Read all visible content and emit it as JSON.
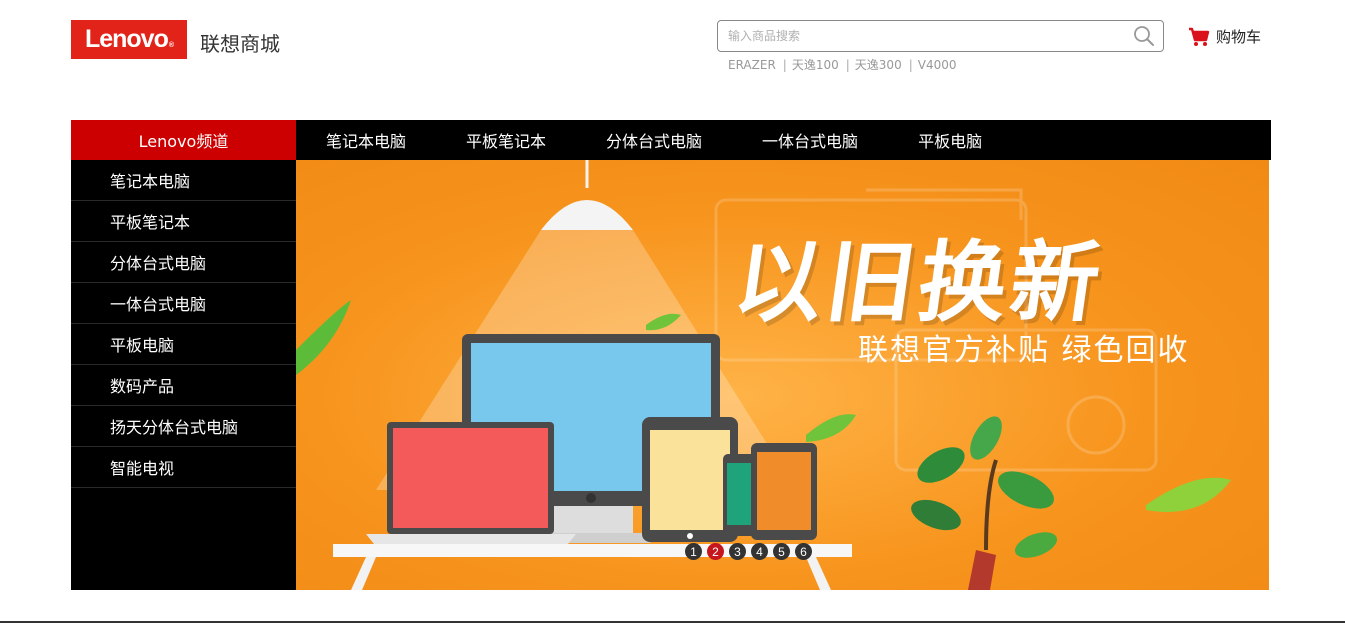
{
  "header": {
    "logo_text": "Lenovo",
    "logo_mark": "®",
    "site_name": "联想商城",
    "search_placeholder": "输入商品搜索",
    "search_icon": "search-icon",
    "hot_words": [
      "ERAZER",
      "天逸100",
      "天逸300",
      "V4000"
    ],
    "cart_label": "购物车",
    "cart_icon": "shopping-cart-icon"
  },
  "nav": {
    "channel_label": "Lenovo频道",
    "items": [
      "笔记本电脑",
      "平板笔记本",
      "分体台式电脑",
      "一体台式电脑",
      "平板电脑"
    ]
  },
  "side_menu": {
    "items": [
      "笔记本电脑",
      "平板笔记本",
      "分体台式电脑",
      "一体台式电脑",
      "平板电脑",
      "数码产品",
      "扬天分体台式电脑",
      "智能电视"
    ]
  },
  "banner": {
    "headline": "以旧换新",
    "subline": "联想官方补贴 绿色回收",
    "slides": [
      "1",
      "2",
      "3",
      "4",
      "5",
      "6"
    ],
    "active_slide": "2"
  },
  "colors": {
    "brand_red": "#e2231a",
    "nav_black": "#000000",
    "banner_orange": "#f7941d",
    "active_dot": "#c4161c"
  }
}
